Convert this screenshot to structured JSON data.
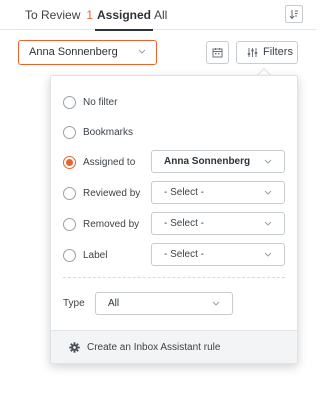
{
  "tabs": {
    "to_review_label": "To Review",
    "to_review_count": "1",
    "assigned_label": "Assigned",
    "all_label": "All"
  },
  "toolbar": {
    "assignee_value": "Anna Sonnenberg",
    "filters_label": "Filters"
  },
  "filter_panel": {
    "options": {
      "no_filter": "No filter",
      "bookmarks": "Bookmarks",
      "assigned_to": "Assigned to",
      "reviewed_by": "Reviewed by",
      "removed_by": "Removed by",
      "label": "Label"
    },
    "selected_option": "assigned_to",
    "assigned_to_value": "Anna Sonnenberg",
    "reviewed_by_value": "- Select -",
    "removed_by_value": "- Select -",
    "label_value": "- Select -",
    "type_label": "Type",
    "type_value": "All",
    "footer_label": "Create an Inbox Assistant rule"
  },
  "colors": {
    "accent": "#e8642d",
    "text": "#3d4349",
    "border": "#c7ccd1",
    "footer_bg": "#f3f4f6"
  },
  "icons": [
    "sort-icon",
    "chevron-down-icon",
    "calendar-icon",
    "filters-sliders-icon",
    "gear-icon"
  ]
}
